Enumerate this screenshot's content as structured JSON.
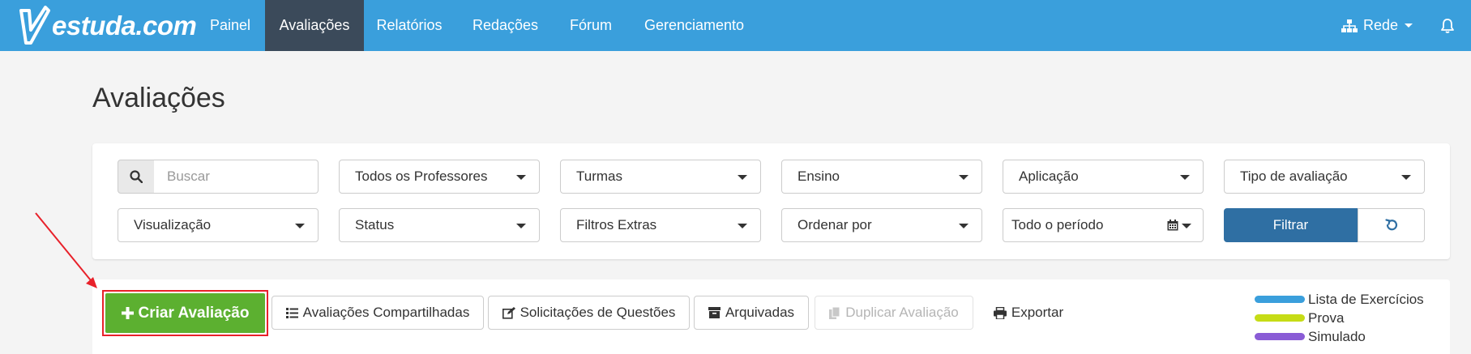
{
  "brand": {
    "name": "estuda.com"
  },
  "nav": {
    "items": [
      {
        "label": "Painel",
        "active": false
      },
      {
        "label": "Avaliações",
        "active": true
      },
      {
        "label": "Relatórios",
        "active": false
      },
      {
        "label": "Redações",
        "active": false
      },
      {
        "label": "Fórum",
        "active": false
      },
      {
        "label": "Gerenciamento",
        "active": false
      }
    ],
    "network_label": "Rede",
    "network_icon": "sitemap-icon",
    "bell_icon": "bell-icon"
  },
  "page": {
    "title": "Avaliações"
  },
  "filters": {
    "search_placeholder": "Buscar",
    "professores": "Todos os Professores",
    "turmas": "Turmas",
    "ensino": "Ensino",
    "aplicacao": "Aplicação",
    "tipo": "Tipo de avaliação",
    "visualizacao": "Visualização",
    "status": "Status",
    "extras": "Filtros Extras",
    "ordenar": "Ordenar por",
    "periodo": "Todo o período",
    "filtrar_label": "Filtrar"
  },
  "actions": {
    "criar": "Criar Avaliação",
    "compartilhadas": "Avaliações Compartilhadas",
    "solicitacoes": "Solicitações de Questões",
    "arquivadas": "Arquivadas",
    "duplicar": "Duplicar Avaliação",
    "exportar": "Exportar"
  },
  "legend": [
    {
      "label": "Lista de Exercícios",
      "color": "#3a9fdc"
    },
    {
      "label": "Prova",
      "color": "#c6dc16"
    },
    {
      "label": "Simulado",
      "color": "#8a5cd6"
    }
  ],
  "colors": {
    "navbar": "#3a9fdc",
    "nav_active": "#3b4a5a",
    "primary_button": "#2f6fa3",
    "create_button": "#5cb030",
    "highlight": "#e8212a"
  }
}
